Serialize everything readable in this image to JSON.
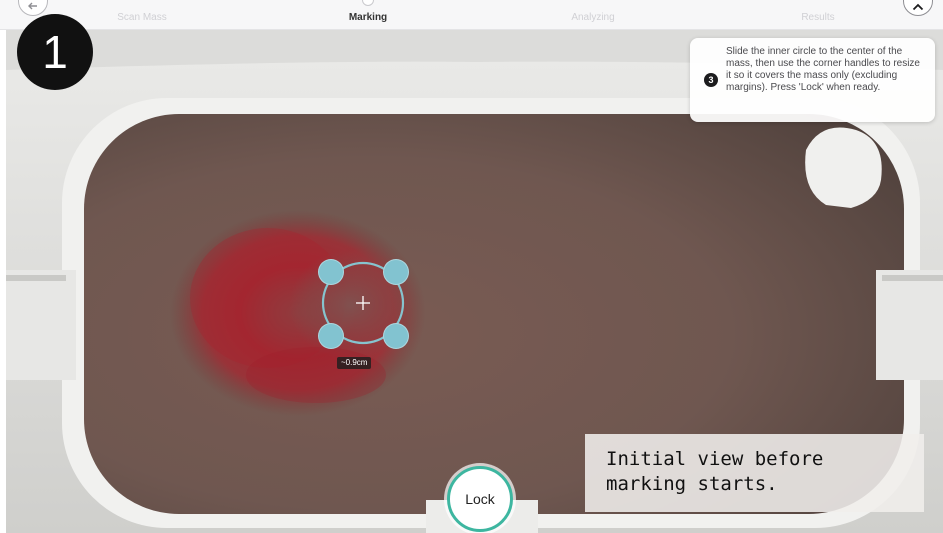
{
  "step_bar": {
    "back_icon": "chevron-left-icon",
    "close_icon": "chevron-up-icon",
    "steps": [
      {
        "label": "Scan Mass",
        "active": false
      },
      {
        "label": "Marking",
        "active": true
      },
      {
        "label": "Analyzing",
        "active": false
      },
      {
        "label": "Results",
        "active": false
      }
    ]
  },
  "step_badge": "1",
  "tooltip": {
    "number": "3",
    "text": "Slide the inner circle to the center of the mass, then use the corner handles to resize it so it covers the mass only (excluding margins). Press 'Lock' when ready."
  },
  "marker": {
    "size_label": "~0.9cm",
    "center_icon": "crosshair-plus-icon",
    "handle_color": "#82c3d0"
  },
  "lock_button": {
    "label": "Lock",
    "accent_color": "#3db6a0"
  },
  "caption": "Initial view before\nmarking starts."
}
